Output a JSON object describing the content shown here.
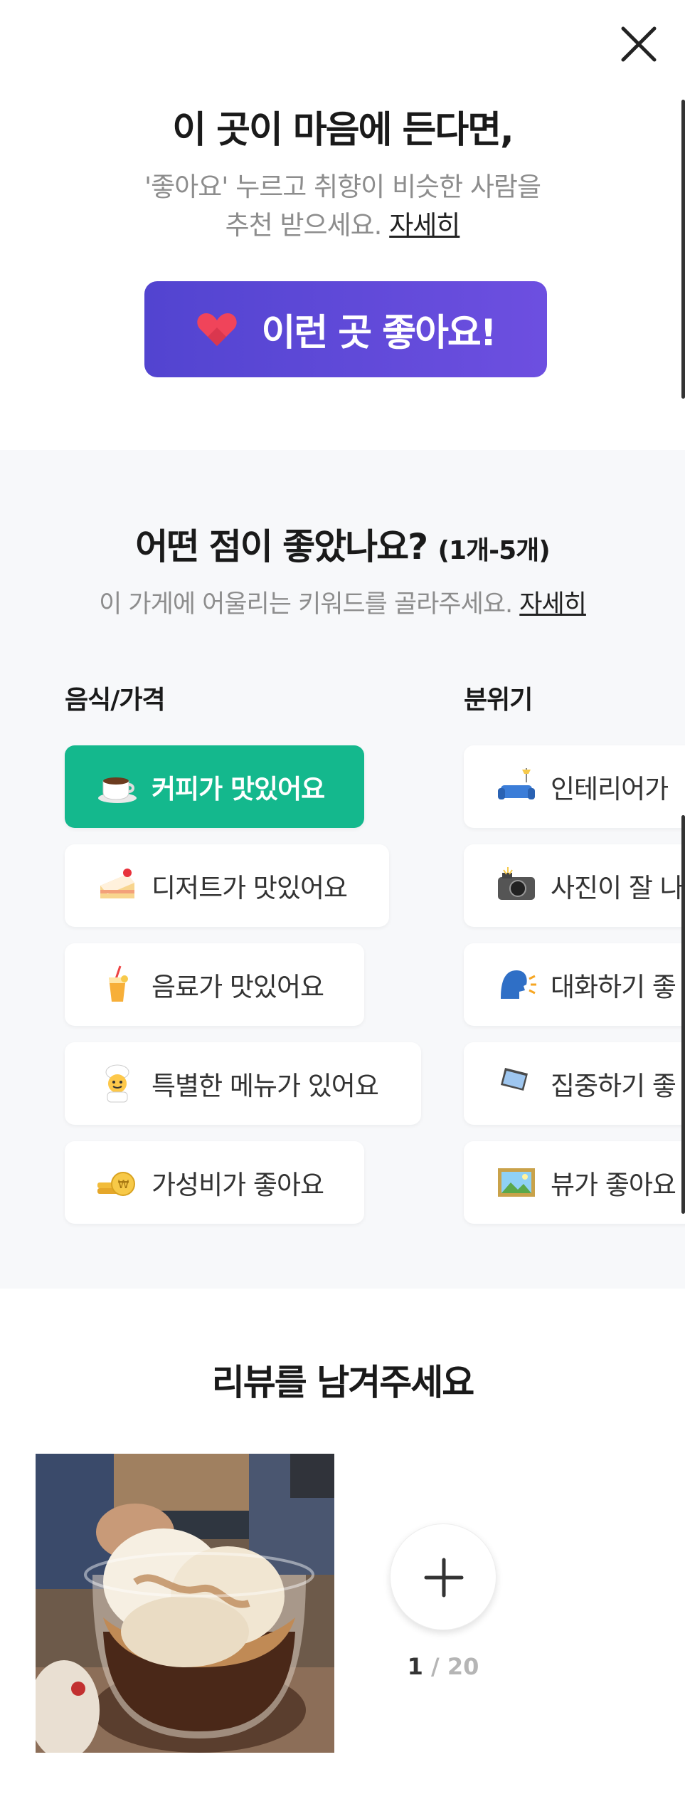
{
  "close": {
    "icon": "close-icon"
  },
  "like": {
    "title": "이 곳이 마음에 든다면,",
    "sub_line1": "'좋아요' 누르고 취향이 비슷한 사람을",
    "sub_line2": "추천 받으세요.",
    "more_link": "자세히",
    "button_label": "이런 곳 좋아요!",
    "button_icon": "heart-icon",
    "colors": {
      "button_start": "#5244d0",
      "button_end": "#6d4fe0",
      "heart": "#f0445a"
    }
  },
  "keywords": {
    "title": "어떤 점이 좋았나요?",
    "count_hint": "(1개-5개)",
    "sub": "이 가게에 어울리는 키워드를 골라주세요.",
    "more_link": "자세히",
    "food_header": "음식/가격",
    "mood_header": "분위기",
    "selected_color": "#14b88d",
    "food": [
      {
        "label": "커피가 맛있어요",
        "icon": "coffee-icon",
        "selected": true
      },
      {
        "label": "디저트가 맛있어요",
        "icon": "cake-icon",
        "selected": false
      },
      {
        "label": "음료가 맛있어요",
        "icon": "drink-icon",
        "selected": false
      },
      {
        "label": "특별한 메뉴가 있어요",
        "icon": "chef-icon",
        "selected": false
      },
      {
        "label": "가성비가 좋아요",
        "icon": "coin-icon",
        "selected": false
      }
    ],
    "mood": [
      {
        "label": "인테리어가",
        "icon": "sofa-icon",
        "selected": false
      },
      {
        "label": "사진이 잘 나",
        "icon": "camera-icon",
        "selected": false
      },
      {
        "label": "대화하기 좋",
        "icon": "talking-icon",
        "selected": false
      },
      {
        "label": "집중하기 좋",
        "icon": "laptop-icon",
        "selected": false
      },
      {
        "label": "뷰가 좋아요",
        "icon": "picture-icon",
        "selected": false
      }
    ]
  },
  "review": {
    "title": "리뷰를 남겨주세요",
    "photo_icon": "dessert-photo",
    "add_icon": "plus-icon",
    "count_current": "1",
    "count_separator": " / ",
    "count_max": "20"
  }
}
